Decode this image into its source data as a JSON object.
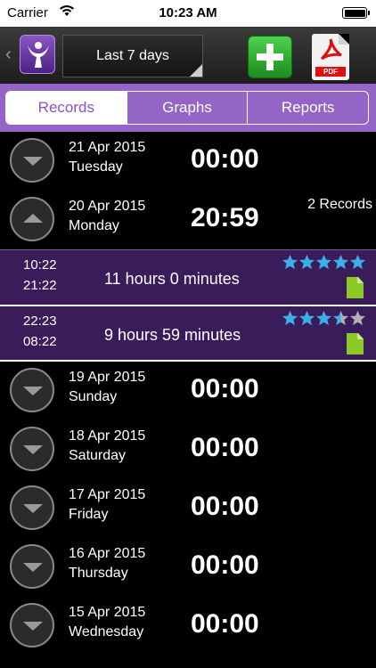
{
  "status_bar": {
    "carrier": "Carrier",
    "time": "10:23 AM"
  },
  "toolbar": {
    "range_label": "Last 7 days",
    "add_icon": "plus-icon",
    "pdf_icon": "pdf-icon",
    "pdf_tag": "PDF"
  },
  "tabs": [
    {
      "label": "Records",
      "active": true
    },
    {
      "label": "Graphs",
      "active": false
    },
    {
      "label": "Reports",
      "active": false
    }
  ],
  "days": [
    {
      "date": "21 Apr 2015",
      "weekday": "Tuesday",
      "total": "00:00",
      "expanded": false,
      "count": ""
    },
    {
      "date": "20 Apr 2015",
      "weekday": "Monday",
      "total": "20:59",
      "expanded": true,
      "count": "2 Records"
    },
    {
      "date": "19 Apr 2015",
      "weekday": "Sunday",
      "total": "00:00",
      "expanded": false,
      "count": ""
    },
    {
      "date": "18 Apr 2015",
      "weekday": "Saturday",
      "total": "00:00",
      "expanded": false,
      "count": ""
    },
    {
      "date": "17 Apr 2015",
      "weekday": "Friday",
      "total": "00:00",
      "expanded": false,
      "count": ""
    },
    {
      "date": "16 Apr 2015",
      "weekday": "Thursday",
      "total": "00:00",
      "expanded": false,
      "count": ""
    },
    {
      "date": "15 Apr 2015",
      "weekday": "Wednesday",
      "total": "00:00",
      "expanded": false,
      "count": ""
    }
  ],
  "records": [
    {
      "start": "10:22",
      "end": "21:22",
      "duration": "11 hours 0 minutes",
      "rating": 5
    },
    {
      "start": "22:23",
      "end": "08:22",
      "duration": "9 hours 59 minutes",
      "rating": 3.5
    }
  ],
  "colors": {
    "accent": "#9464c6",
    "record_bg": "#3a1c5b",
    "star": "#3ab0e8",
    "star_empty": "#b0b0b0",
    "doc": "#8ac926"
  }
}
